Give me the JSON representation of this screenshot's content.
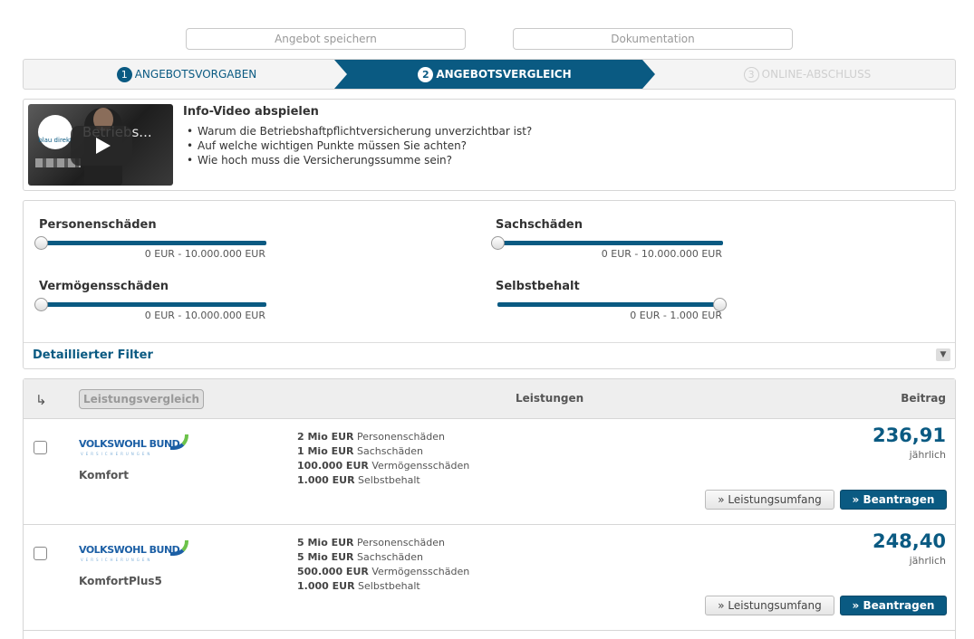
{
  "top_buttons": {
    "save": "Angebot speichern",
    "doc": "Dokumentation"
  },
  "steps": [
    {
      "num": "1",
      "label": "ANGEBOTSVORGABEN"
    },
    {
      "num": "2",
      "label": "ANGEBOTSVERGLEICH"
    },
    {
      "num": "3",
      "label": "ONLINE-ABSCHLUSS"
    }
  ],
  "video": {
    "thumb_title": "Betriebs...",
    "logo_text": "blau direkt",
    "title": "Info-Video abspielen",
    "bullets": [
      "Warum die Betriebshaftpflichtversicherung unverzichtbar ist?",
      "Auf welche wichtigen Punkte müssen Sie achten?",
      "Wie hoch muss die Versicherungssumme sein?"
    ]
  },
  "filters": [
    {
      "label": "Personenschäden",
      "range": "0 EUR - 10.000.000 EUR",
      "value": 0
    },
    {
      "label": "Sachschäden",
      "range": "0 EUR - 10.000.000 EUR",
      "value": 0
    },
    {
      "label": "Vermögensschäden",
      "range": "0 EUR - 10.000.000 EUR",
      "value": 0
    },
    {
      "label": "Selbstbehalt",
      "range": "0 EUR - 1.000 EUR",
      "value": 1
    }
  ],
  "detail_filter": "Detaillierter Filter",
  "results_header": {
    "compare": "Leistungsvergleich",
    "benefits": "Leistungen",
    "premium": "Beitrag"
  },
  "offers": [
    {
      "insurer": "VOLKSWOHL BUND",
      "insurer_sub": "VERSICHERUNGEN",
      "tariff": "Komfort",
      "features": [
        {
          "amount": "2 Mio EUR",
          "label": "Personenschäden"
        },
        {
          "amount": "1 Mio EUR",
          "label": "Sachschäden"
        },
        {
          "amount": "100.000 EUR",
          "label": "Vermögensschäden"
        },
        {
          "amount": "1.000 EUR",
          "label": "Selbstbehalt"
        }
      ],
      "price": "236,91",
      "period": "jährlich",
      "btn_scope": "» Leistungsumfang",
      "btn_apply": "» Beantragen"
    },
    {
      "insurer": "VOLKSWOHL BUND",
      "insurer_sub": "VERSICHERUNGEN",
      "tariff": "KomfortPlus5",
      "features": [
        {
          "amount": "5 Mio EUR",
          "label": "Personenschäden"
        },
        {
          "amount": "5 Mio EUR",
          "label": "Sachschäden"
        },
        {
          "amount": "500.000 EUR",
          "label": "Vermögensschäden"
        },
        {
          "amount": "1.000 EUR",
          "label": "Selbstbehalt"
        }
      ],
      "price": "248,40",
      "period": "jährlich",
      "btn_scope": "» Leistungsumfang",
      "btn_apply": "» Beantragen"
    }
  ],
  "colors": {
    "accent": "#0a5a82",
    "border": "#d6d6d6"
  }
}
